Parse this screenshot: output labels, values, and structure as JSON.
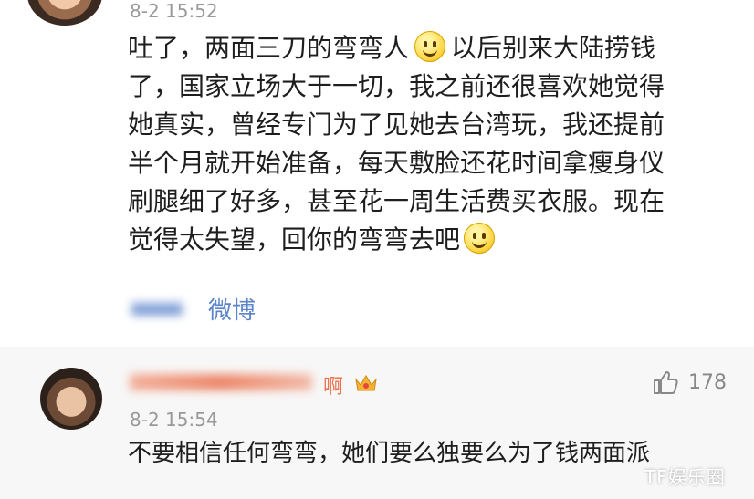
{
  "first_comment": {
    "timestamp": "8-2 15:52",
    "line1": "吐了，两面三刀的弯弯人",
    "line1b": "以后别来大陆捞钱",
    "line2": "了，国家立场大于一切，我之前还很喜欢她觉得",
    "line3": "她真实，曾经专门为了见她去台湾玩，我还提前",
    "line4": "半个月就开始准备，每天敷脸还花时间拿瘦身仪",
    "line5": "刷腿细了好多，甚至花一周生活费买衣服。现在",
    "line6": "觉得太失望，回你的弯弯去吧",
    "source_label": "微博",
    "emoji_icon": "smile-emoji-icon"
  },
  "second_comment": {
    "username": "啊",
    "timestamp": "8-2 15:54",
    "text": "不要相信任何弯弯，她们要么独要么为了钱两面派",
    "like_count": "178",
    "badge_icon": "crown-badge-icon"
  },
  "watermark": "TF娱乐圈",
  "colors": {
    "username": "#eb7350",
    "link": "#5b84c9",
    "timestamp": "#999999",
    "second_bg": "#f7f7f7"
  }
}
